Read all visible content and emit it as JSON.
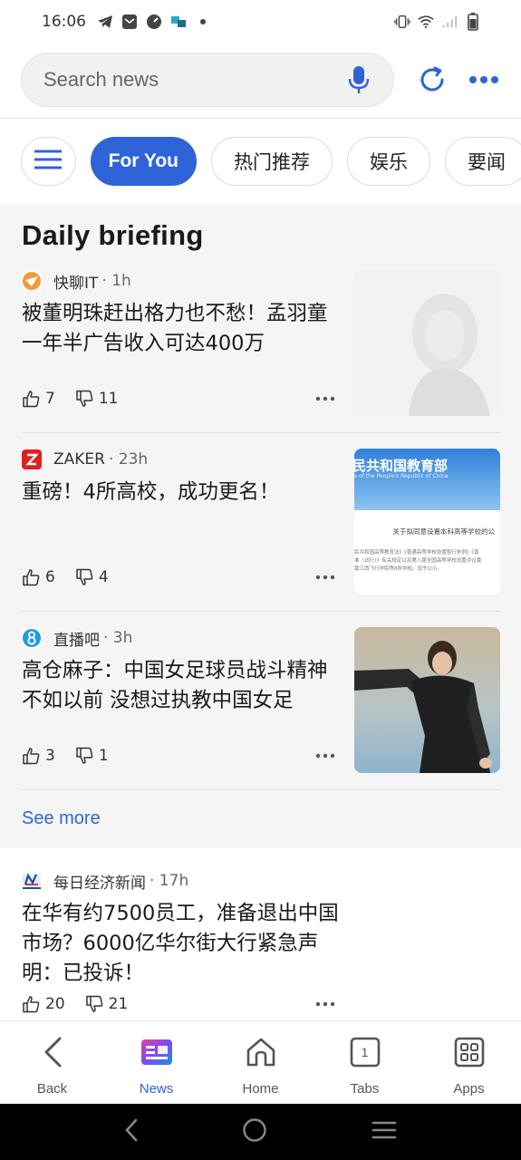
{
  "status_bar": {
    "time": "16:06",
    "left_icons": [
      "telegram-icon",
      "mail-icon",
      "app-icon",
      "translate-icon",
      "dot-icon"
    ],
    "right_icons": [
      "vibrate-icon",
      "wifi-icon",
      "signal-icon",
      "battery-icon"
    ]
  },
  "search": {
    "placeholder": "Search news"
  },
  "chips": {
    "active": "For You",
    "items": [
      "热门推荐",
      "娱乐",
      "要闻"
    ]
  },
  "briefing": {
    "title": "Daily briefing",
    "articles": [
      {
        "source": "快聊IT",
        "meta": "· 1h",
        "headline": "被董明珠赶出格力也不愁！孟羽童一年半广告收入可达400万",
        "likes": "7",
        "dislikes": "11"
      },
      {
        "source": "ZAKER",
        "meta": "· 23h",
        "headline": "重磅！4所高校，成功更名！",
        "likes": "6",
        "dislikes": "4",
        "thumb_heading": "民共和国教育部",
        "thumb_sub": "s of the People's Republic of China",
        "thumb_title": "关于拟同意设置本科高等学校的公",
        "thumb_body1": "民共和国高等教育法》《普通高等学校设置暂行条例》《普",
        "thumb_body2": "准（试行）》有关规定以及第八届全国高等学校设置评议委",
        "thumb_body3": "黄江西飞行学院等8所学校。现予公示。"
      },
      {
        "source": "直播吧",
        "meta": "· 3h",
        "headline": "高仓麻子：中国女足球员战斗精神不如以前 没想过执教中国女足",
        "likes": "3",
        "dislikes": "1"
      }
    ],
    "see_more": "See more"
  },
  "feed": {
    "source": "每日经济新闻",
    "meta": "· 17h",
    "headline": "在华有约7500员工，准备退出中国市场？6000亿华尔街大行紧急声明：已投诉！",
    "likes": "20",
    "dislikes": "21"
  },
  "bottom_nav": {
    "items": [
      {
        "label": "Back",
        "icon": "chevron-left-icon"
      },
      {
        "label": "News",
        "icon": "news-icon"
      },
      {
        "label": "Home",
        "icon": "home-icon"
      },
      {
        "label": "Tabs",
        "icon": "tabs-icon",
        "count": "1"
      },
      {
        "label": "Apps",
        "icon": "apps-grid-icon"
      }
    ]
  },
  "colors": {
    "accent": "#2f64d8",
    "briefing_bg": "#f5f5f5"
  }
}
